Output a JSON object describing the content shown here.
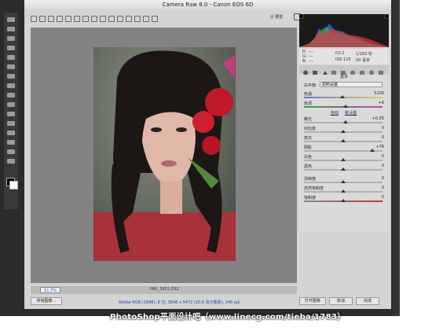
{
  "dialog": {
    "title": "Camera Raw 8.0 - Canon EOS 6D",
    "preview_label": "预览",
    "zoom_value": "11.7%",
    "filename": "IMG_3951.CR2",
    "info_line": "Adobe RGB (1998); 8 位; 3648 x 5472 (20.0 百万像素); 240 ppi",
    "buttons": {
      "save": "存储图像...",
      "open": "打开图像",
      "cancel": "取消",
      "done": "完成"
    }
  },
  "readout": {
    "rgb_r": "R:",
    "rgb_g": "G:",
    "rgb_b": "B:",
    "dash": "---",
    "exposure": "f/2.2",
    "shutter": "1/160 秒",
    "iso": "ISO 125",
    "focal": "50 毫米"
  },
  "panel": {
    "title": "基本",
    "white_balance_label": "白平衡:",
    "white_balance_value": "原照设置",
    "auto_label": "自动",
    "default_label": "默认值",
    "sliders": [
      {
        "label": "色温",
        "value": "5200"
      },
      {
        "label": "色调",
        "value": "+6"
      },
      {
        "label": "曝光",
        "value": "+0.35"
      },
      {
        "label": "对比度",
        "value": "0"
      },
      {
        "label": "高光",
        "value": "0"
      },
      {
        "label": "阴影",
        "value": "+76"
      },
      {
        "label": "白色",
        "value": "0"
      },
      {
        "label": "黑色",
        "value": "0"
      },
      {
        "label": "清晰度",
        "value": "0"
      },
      {
        "label": "自然饱和度",
        "value": "0"
      },
      {
        "label": "饱和度",
        "value": "0"
      }
    ]
  },
  "watermark": "PhotoShop平面设计吧（www.linecg.com/tieba/1783）"
}
